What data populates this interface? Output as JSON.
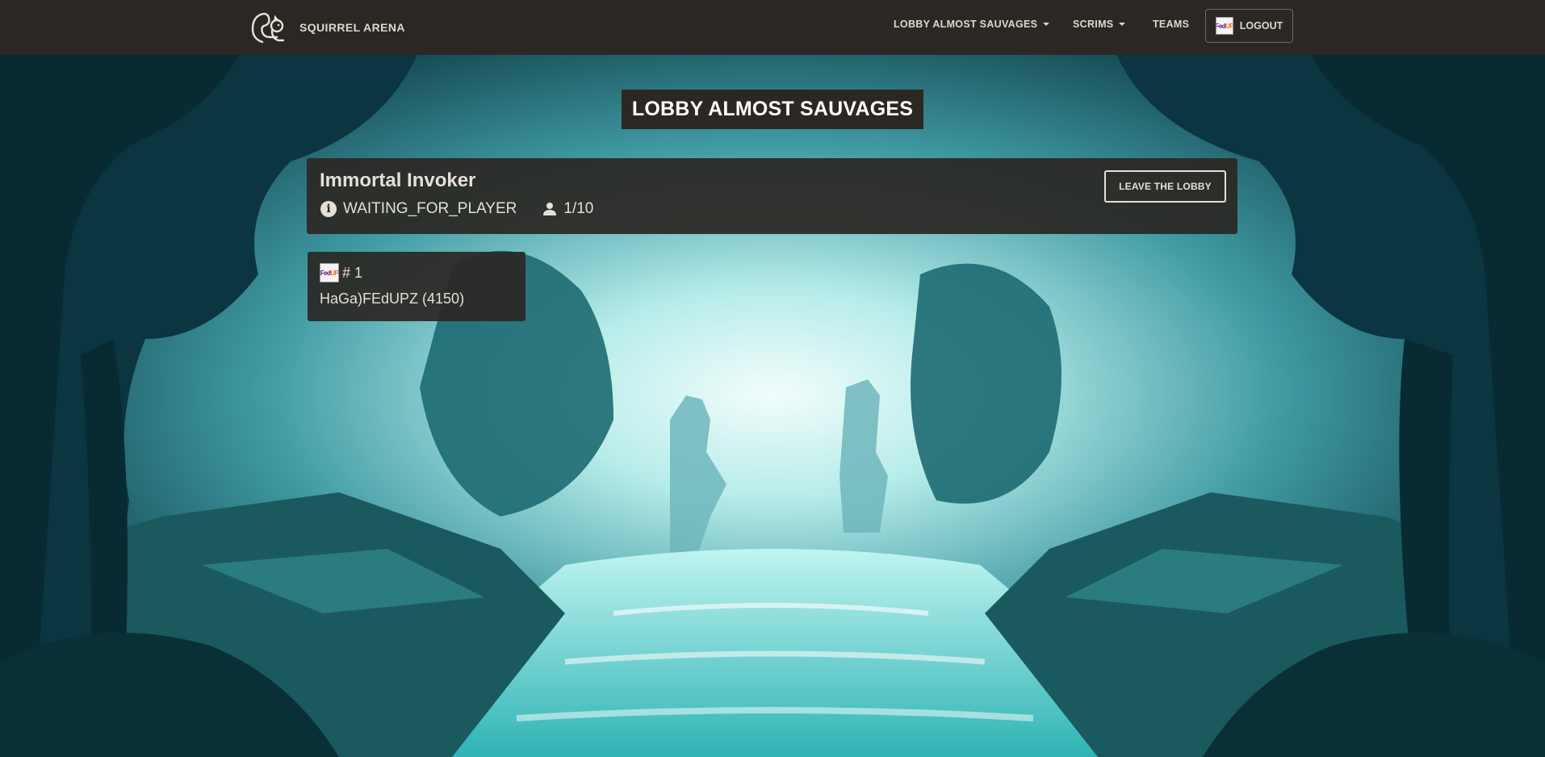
{
  "navbar": {
    "brand": "SQUIRREL ARENA",
    "brand_icon": "squirrel-icon",
    "items": [
      {
        "label": "LOBBY ALMOST SAUVAGES",
        "dropdown": true
      },
      {
        "label": "SCRIMS",
        "dropdown": true
      },
      {
        "label": "TEAMS",
        "dropdown": false
      }
    ],
    "logout": {
      "label": "LOGOUT",
      "avatar_icon": "fedup-avatar"
    }
  },
  "page": {
    "title": "LOBBY ALMOST SAUVAGES"
  },
  "lobby": {
    "name": "Immortal Invoker",
    "status_icon": "info-icon",
    "status": "WAITING_FOR_PLAYER",
    "players_icon": "person-icon",
    "players": "1/10",
    "leave_label": "LEAVE THE LOBBY"
  },
  "players": [
    {
      "rank": "# 1",
      "name": "HaGa)FEdUPZ (4150)",
      "avatar_icon": "fedup-avatar"
    }
  ],
  "colors": {
    "navbar_bg": "#2b2823",
    "card_bg": "#2b2823",
    "text_light": "#e4e0d8",
    "fedup_purple": "#4d148c",
    "fedup_orange": "#ff6600"
  }
}
